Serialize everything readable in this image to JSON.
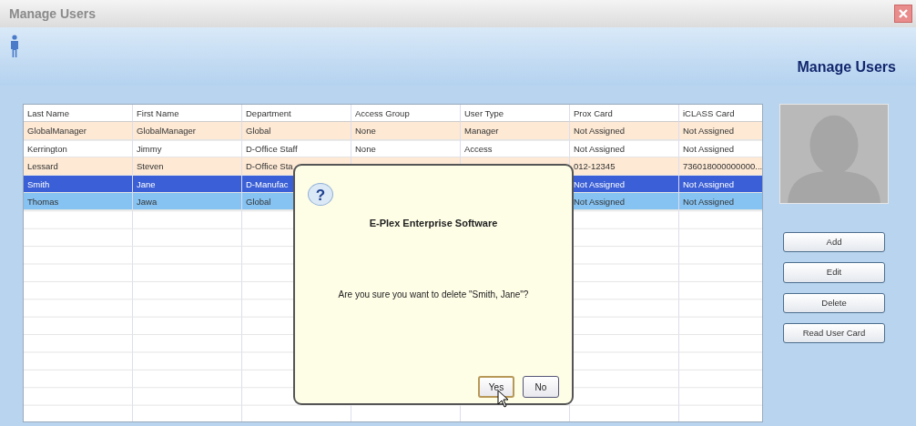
{
  "window": {
    "title": "Manage Users"
  },
  "header": {
    "title": "Manage Users"
  },
  "table": {
    "columns": [
      "Last Name",
      "First Name",
      "Department",
      "Access Group",
      "User Type",
      "Prox Card",
      "iCLASS Card"
    ],
    "rows": [
      {
        "selected": false,
        "focused": false,
        "cells": [
          "GlobalManager",
          "GlobalManager",
          "Global",
          "None",
          "Manager",
          "Not Assigned",
          "Not Assigned"
        ]
      },
      {
        "selected": false,
        "focused": false,
        "cells": [
          "Kerrington",
          "Jimmy",
          "D-Office Staff",
          "None",
          "Access",
          "Not Assigned",
          "Not Assigned"
        ]
      },
      {
        "selected": false,
        "focused": false,
        "cells": [
          "Lessard",
          "Steven",
          "D-Office Sta",
          null,
          null,
          "012-12345",
          "736018000000000..."
        ]
      },
      {
        "selected": true,
        "focused": false,
        "cells": [
          "Smith",
          "Jane",
          "D-Manufac",
          null,
          null,
          "Not Assigned",
          "Not Assigned"
        ]
      },
      {
        "selected": false,
        "focused": true,
        "cells": [
          "Thomas",
          "Jawa",
          "Global",
          null,
          null,
          "Not Assigned",
          "Not Assigned"
        ]
      }
    ]
  },
  "buttons": [
    "Add",
    "Edit",
    "Delete",
    "Read User Card"
  ],
  "dialog": {
    "icon": "?",
    "title": "E-Plex Enterprise Software",
    "message": "Are you sure you want to delete \"Smith, Jane\"?",
    "buttons": [
      {
        "label": "Yes",
        "focused": true
      },
      {
        "label": "No",
        "focused": false
      }
    ]
  }
}
